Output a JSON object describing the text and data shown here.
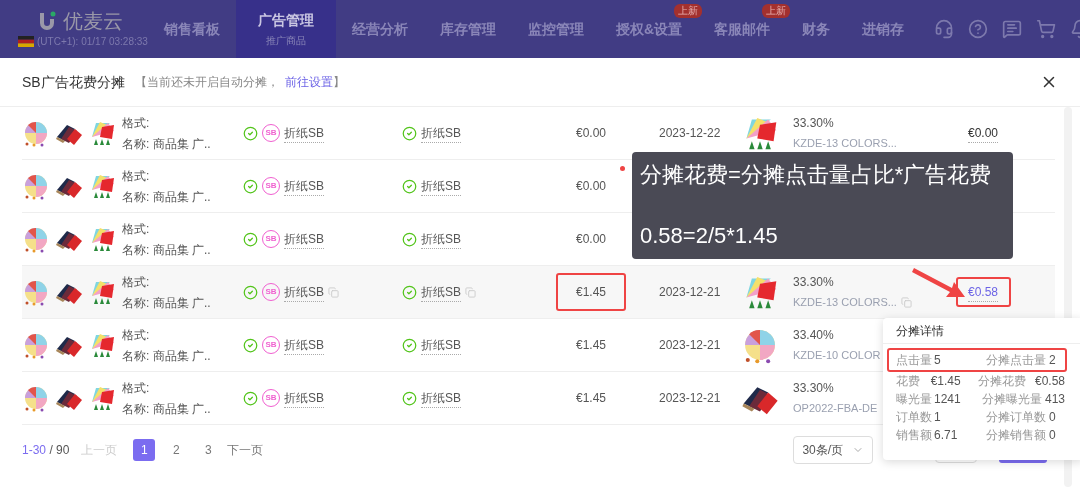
{
  "nav": {
    "logo": "优麦云",
    "timezone": "(UTC+1): 01/17 03:28:33",
    "tabs": [
      {
        "label": "销售看板",
        "selected": false
      },
      {
        "label": "广告管理",
        "sub": "推广商品",
        "selected": true
      },
      {
        "label": "经营分析",
        "selected": false
      },
      {
        "label": "库存管理",
        "selected": false
      },
      {
        "label": "监控管理",
        "selected": false
      },
      {
        "label": "授权&设置",
        "badge": "上新",
        "selected": false
      },
      {
        "label": "客服邮件",
        "badge": "上新",
        "selected": false
      },
      {
        "label": "财务",
        "selected": false
      },
      {
        "label": "进销存",
        "selected": false
      }
    ]
  },
  "dialog": {
    "title": "SB广告花费分摊",
    "notice_open": "【当前还未开启自动分摊，",
    "notice_link": "前往设置",
    "notice_close": "】"
  },
  "rows": [
    {
      "format_label": "格式:",
      "name_label": "名称:",
      "name": "商品集 广..",
      "sb_badge": "SB",
      "campaign": "折纸SB",
      "group": "折纸SB",
      "spend": "€0.00",
      "date": "2023-12-22",
      "share": "33.30%",
      "sku": "KZDE-13 COLORS...",
      "allocation": "€0.00",
      "hovered": false,
      "boxed": false
    },
    {
      "format_label": "格式:",
      "name_label": "名称:",
      "name": "商品集 广..",
      "sb_badge": "SB",
      "campaign": "折纸SB",
      "group": "折纸SB",
      "spend": "€0.00",
      "hovered": false,
      "boxed": false
    },
    {
      "format_label": "格式:",
      "name_label": "名称:",
      "name": "商品集 广..",
      "sb_badge": "SB",
      "campaign": "折纸SB",
      "group": "折纸SB",
      "spend": "€0.00",
      "hovered": false,
      "boxed": false
    },
    {
      "format_label": "格式:",
      "name_label": "名称:",
      "name": "商品集 广..",
      "sb_badge": "SB",
      "campaign": "折纸SB",
      "group": "折纸SB",
      "spend": "€1.45",
      "date": "2023-12-21",
      "share": "33.30%",
      "sku": "KZDE-13 COLORS...",
      "allocation": "€0.58",
      "hovered": true,
      "boxed": true
    },
    {
      "format_label": "格式:",
      "name_label": "名称:",
      "name": "商品集 广..",
      "sb_badge": "SB",
      "campaign": "折纸SB",
      "group": "折纸SB",
      "spend": "€1.45",
      "date": "2023-12-21",
      "share": "33.40%",
      "sku": "KZDE-10 COLOR",
      "hovered": false,
      "boxed": false
    },
    {
      "format_label": "格式:",
      "name_label": "名称:",
      "name": "商品集 广..",
      "sb_badge": "SB",
      "campaign": "折纸SB",
      "group": "折纸SB",
      "spend": "€1.45",
      "date": "2023-12-21",
      "share": "33.30%",
      "sku": "OP2022-FBA-DE",
      "hovered": false,
      "boxed": false
    }
  ],
  "tooltip": {
    "lines": [
      "分摊花费=分摊点击量占比*广告花费",
      "0.58=2/5*1.45"
    ]
  },
  "popover": {
    "title": "分摊详情",
    "rows": [
      {
        "left_label": "点击量",
        "left_value": "5",
        "right_label": "分摊点击量",
        "right_value": "2",
        "boxed": true
      },
      {
        "left_label": "花费",
        "left_value": "€1.45",
        "right_label": "分摊花费",
        "right_value": "€0.58",
        "boxed": false
      },
      {
        "left_label": "曝光量",
        "left_value": "1241",
        "right_label": "分摊曝光量",
        "right_value": "413",
        "boxed": false
      },
      {
        "left_label": "订单数",
        "left_value": "1",
        "right_label": "分摊订单数",
        "right_value": "0",
        "boxed": false
      },
      {
        "left_label": "销售额",
        "left_value": "6.71",
        "right_label": "分摊销售额",
        "right_value": "0",
        "boxed": false
      }
    ]
  },
  "pagination": {
    "range": "1-30",
    "total": "/ 90",
    "prev": "上一页",
    "prev_disabled": true,
    "pages": [
      {
        "label": "1",
        "selected": true
      },
      {
        "label": "2",
        "selected": false
      },
      {
        "label": "3",
        "selected": false
      }
    ],
    "next": "下一页",
    "page_size": "30条/页"
  }
}
